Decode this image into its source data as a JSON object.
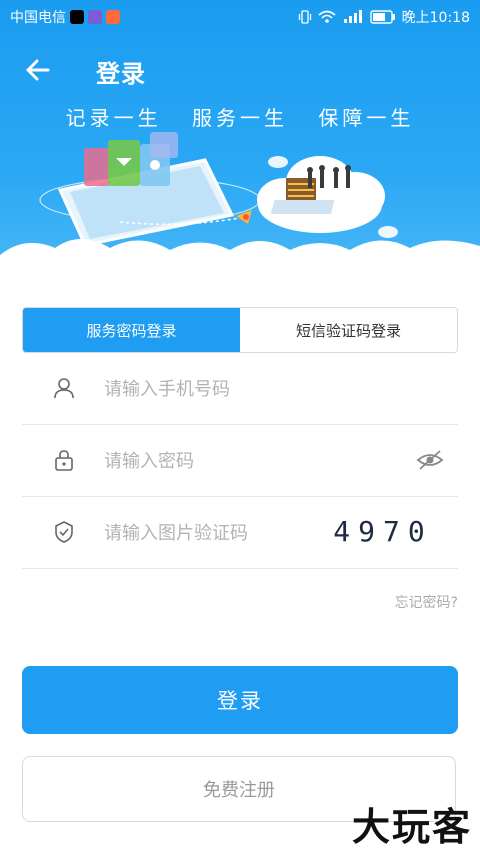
{
  "statusbar": {
    "carrier": "中国电信",
    "time": "晚上10:18"
  },
  "header": {
    "title": "登录",
    "slogan": [
      "记录一生",
      "服务一生",
      "保障一生"
    ]
  },
  "tabs": [
    {
      "label": "服务密码登录",
      "active": true
    },
    {
      "label": "短信验证码登录",
      "active": false
    }
  ],
  "form": {
    "phone_placeholder": "请输入手机号码",
    "password_placeholder": "请输入密码",
    "captcha_placeholder": "请输入图片验证码",
    "captcha_code": "4970"
  },
  "links": {
    "forgot_password": "忘记密码?"
  },
  "buttons": {
    "login": "登录",
    "register": "免费注册"
  },
  "watermark": "大玩客",
  "colors": {
    "primary": "#1e9df2",
    "banner_top": "#1a9cf0"
  }
}
